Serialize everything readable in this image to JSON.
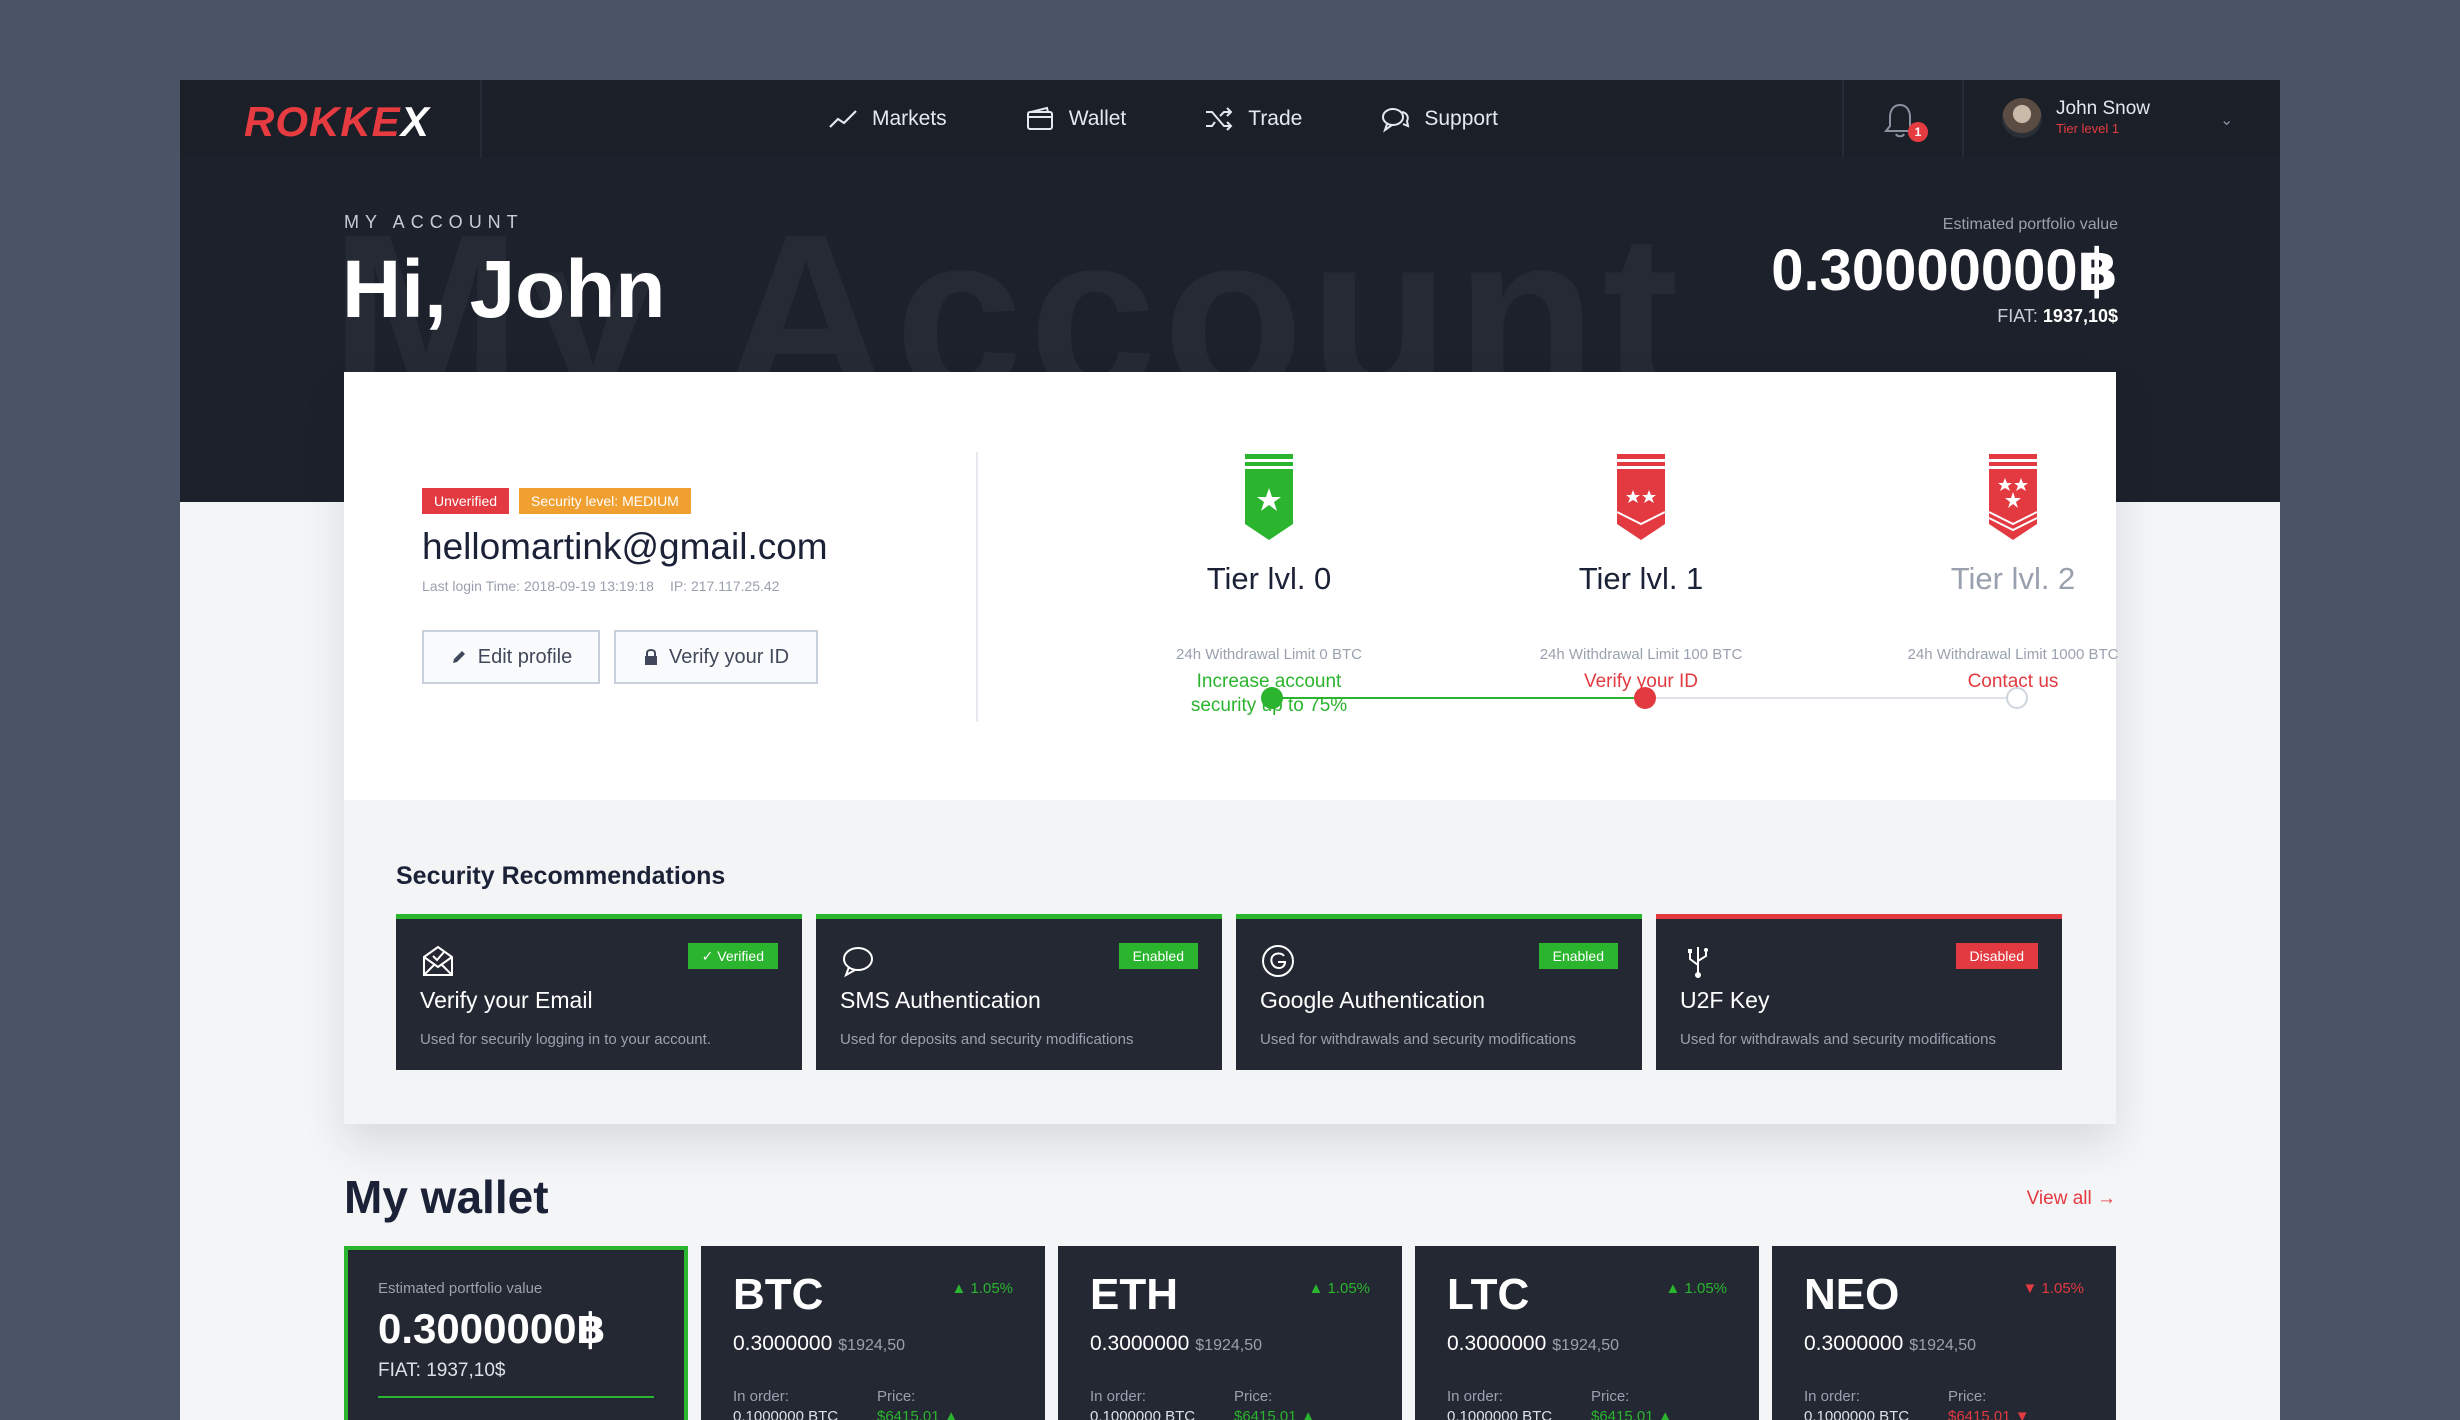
{
  "app": {
    "logo": "ROKKEX"
  },
  "nav": {
    "items": [
      {
        "label": "Markets",
        "icon": "chart-line-icon"
      },
      {
        "label": "Wallet",
        "icon": "wallet-icon"
      },
      {
        "label": "Trade",
        "icon": "shuffle-icon"
      },
      {
        "label": "Support",
        "icon": "chat-bubbles-icon"
      }
    ],
    "notifications": "1",
    "user": {
      "name": "John Snow",
      "tier": "Tier level 1"
    }
  },
  "hero": {
    "watermark": "My Account",
    "label": "MY ACCOUNT",
    "greeting": "Hi, John",
    "portfolio_label": "Estimated portfolio value",
    "portfolio_value": "0.30000000฿",
    "fiat_label": "FIAT:",
    "fiat_value": "1937,10$"
  },
  "account": {
    "badge_unverified": "Unverified",
    "badge_security": "Security level: MEDIUM",
    "email": "hellomartink@gmail.com",
    "last_login": "Last login Time: 2018-09-19 13:19:18",
    "ip": "IP: 217.117.25.42",
    "edit_profile": "Edit profile",
    "verify_id": "Verify your ID"
  },
  "tiers": [
    {
      "name": "Tier lvl. 0",
      "limit": "24h Withdrawal Limit 0 BTC",
      "action": "Increase account security up to 75%"
    },
    {
      "name": "Tier lvl. 1",
      "limit": "24h Withdrawal Limit 100 BTC",
      "action": "Verify your ID"
    },
    {
      "name": "Tier lvl. 2",
      "limit": "24h Withdrawal Limit 1000 BTC",
      "action": "Contact us"
    }
  ],
  "security": {
    "title": "Security Recommendations",
    "items": [
      {
        "name": "Verify your Email",
        "desc": "Used for securily logging in to your account.",
        "status": "✓ Verified",
        "icon": "envelope-icon"
      },
      {
        "name": "SMS Authentication",
        "desc": "Used for deposits and security modifications",
        "status": "Enabled",
        "icon": "message-icon"
      },
      {
        "name": "Google Authentication",
        "desc": "Used for withdrawals and security modifications",
        "status": "Enabled",
        "icon": "google-icon"
      },
      {
        "name": "U2F Key",
        "desc": "Used for withdrawals and security modifications",
        "status": "Disabled",
        "icon": "usb-icon"
      }
    ]
  },
  "wallet": {
    "title": "My wallet",
    "view_all": "View all →",
    "summary": {
      "label": "Estimated portfolio value",
      "value": "0.3000000฿",
      "fiat": "FIAT: 1937,10$"
    },
    "coins": [
      {
        "symbol": "BTC",
        "change": "▲ 1.05%",
        "balance": "0.3000000",
        "fiat": "$1924,50",
        "in_order_label": "In order:",
        "in_order": "0.1000000 BTC",
        "price_label": "Price:",
        "price": "$6415.01 ▲"
      },
      {
        "symbol": "ETH",
        "change": "▲ 1.05%",
        "balance": "0.3000000",
        "fiat": "$1924,50",
        "in_order_label": "In order:",
        "in_order": "0.1000000 BTC",
        "price_label": "Price:",
        "price": "$6415.01 ▲"
      },
      {
        "symbol": "LTC",
        "change": "▲ 1.05%",
        "balance": "0.3000000",
        "fiat": "$1924,50",
        "in_order_label": "In order:",
        "in_order": "0.1000000 BTC",
        "price_label": "Price:",
        "price": "$6415.01 ▲"
      },
      {
        "symbol": "NEO",
        "change": "▼ 1.05%",
        "balance": "0.3000000",
        "fiat": "$1924,50",
        "in_order_label": "In order:",
        "in_order": "0.1000000 BTC",
        "price_label": "Price:",
        "price": "$6415.01 ▼"
      }
    ]
  },
  "colors": {
    "accent_red": "#e23a40",
    "accent_green": "#2bb42e",
    "dark": "#1d212b"
  }
}
